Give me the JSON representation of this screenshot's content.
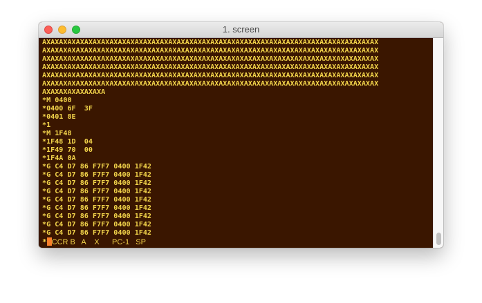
{
  "window": {
    "title": "1. screen"
  },
  "colors": {
    "terminal_bg": "#3a1600",
    "terminal_fg": "#f3d54b",
    "cursor": "#f77f2a"
  },
  "terminal": {
    "lines": [
      "AXAXAXAXAXAXAXAXAXAXAXAXAXAXAXAXAXAXAXAXAXAXAXAXAXAXAXAXAXAXAXAXAXAXAXAXAXAXAXAX",
      "AXAXAXAXAXAXAXAXAXAXAXAXAXAXAXAXAXAXAXAXAXAXAXAXAXAXAXAXAXAXAXAXAXAXAXAXAXAXAXAX",
      "AXAXAXAXAXAXAXAXAXAXAXAXAXAXAXAXAXAXAXAXAXAXAXAXAXAXAXAXAXAXAXAXAXAXAXAXAXAXAXAX",
      "AXAXAXAXAXAXAXAXAXAXAXAXAXAXAXAXAXAXAXAXAXAXAXAXAXAXAXAXAXAXAXAXAXAXAXAXAXAXAXAX",
      "AXAXAXAXAXAXAXAXAXAXAXAXAXAXAXAXAXAXAXAXAXAXAXAXAXAXAXAXAXAXAXAXAXAXAXAXAXAXAXAX",
      "AXAXAXAXAXAXAXAXAXAXAXAXAXAXAXAXAXAXAXAXAXAXAXAXAXAXAXAXAXAXAXAXAXAXAXAXAXAXAXAX",
      "AXAXAXAXAXAXAXA",
      "*M 0400",
      "*0400 6F  3F",
      "*0401 8E",
      "*1",
      "*M 1F48",
      "*1F48 1D  04",
      "*1F49 70  00",
      "*1F4A 0A",
      "*G C4 D7 86 F7F7 0400 1F42",
      "*G C4 D7 86 F7F7 0400 1F42",
      "*G C4 D7 86 F7F7 0400 1F42",
      "*G C4 D7 86 F7F7 0400 1F42",
      "*G C4 D7 86 F7F7 0400 1F42",
      "*G C4 D7 86 F7F7 0400 1F42",
      "*G C4 D7 86 F7F7 0400 1F42",
      "*G C4 D7 86 F7F7 0400 1F42",
      "*G C4 D7 86 F7F7 0400 1F42"
    ],
    "prompt": "*",
    "status_text": "CCR B   A    X      PC-1   SP"
  }
}
